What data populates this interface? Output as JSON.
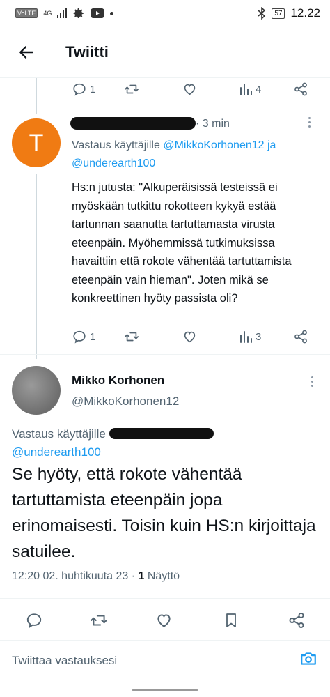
{
  "status_bar": {
    "volte": "VoLTE",
    "signal": "4G",
    "battery": "57",
    "time": "12.22"
  },
  "header": {
    "title": "Twiitti"
  },
  "top_actions": {
    "replies": "1",
    "views": "4"
  },
  "reply_tweet": {
    "avatar_letter": "T",
    "name_visible_tail": "",
    "time_ago": "· 3 min",
    "reply_prefix": "Vastaus käyttäjille ",
    "mention_1": "@MikkoKorhonen12",
    "joiner": " ja ",
    "mention_2": "@underearth100",
    "body": "Hs:n jutusta: \"Alkuperäisissä testeissä ei myöskään tutkittu rokotteen kykyä estää tartunnan saanutta tartuttamasta virusta eteenpäin. Myöhemmissä tutkimuksissa havaittiin että rokote vähentää tartuttamista eteenpäin vain hieman\". Joten mikä se konkreettinen hyöty passista oli?",
    "replies": "1",
    "views": "3"
  },
  "main_tweet": {
    "name": "Mikko Korhonen",
    "handle": "@MikkoKorhonen12",
    "reply_prefix": "Vastaus käyttäjille ",
    "mention_2": "@underearth100",
    "body": "Se hyöty, että rokote vähentää tartuttamista eteenpäin jopa erinomaisesti. Toisin kuin HS:n kirjoittaja satuilee.",
    "timestamp": "12:20 02. huhtikuuta 23 · ",
    "views_count": "1",
    "views_label": " Näyttö"
  },
  "compose": {
    "placeholder": "Twiittaa vastauksesi"
  },
  "colors": {
    "accent": "#1d9bf0",
    "avatar_orange": "#f07b13",
    "secondary_text": "#536471"
  }
}
